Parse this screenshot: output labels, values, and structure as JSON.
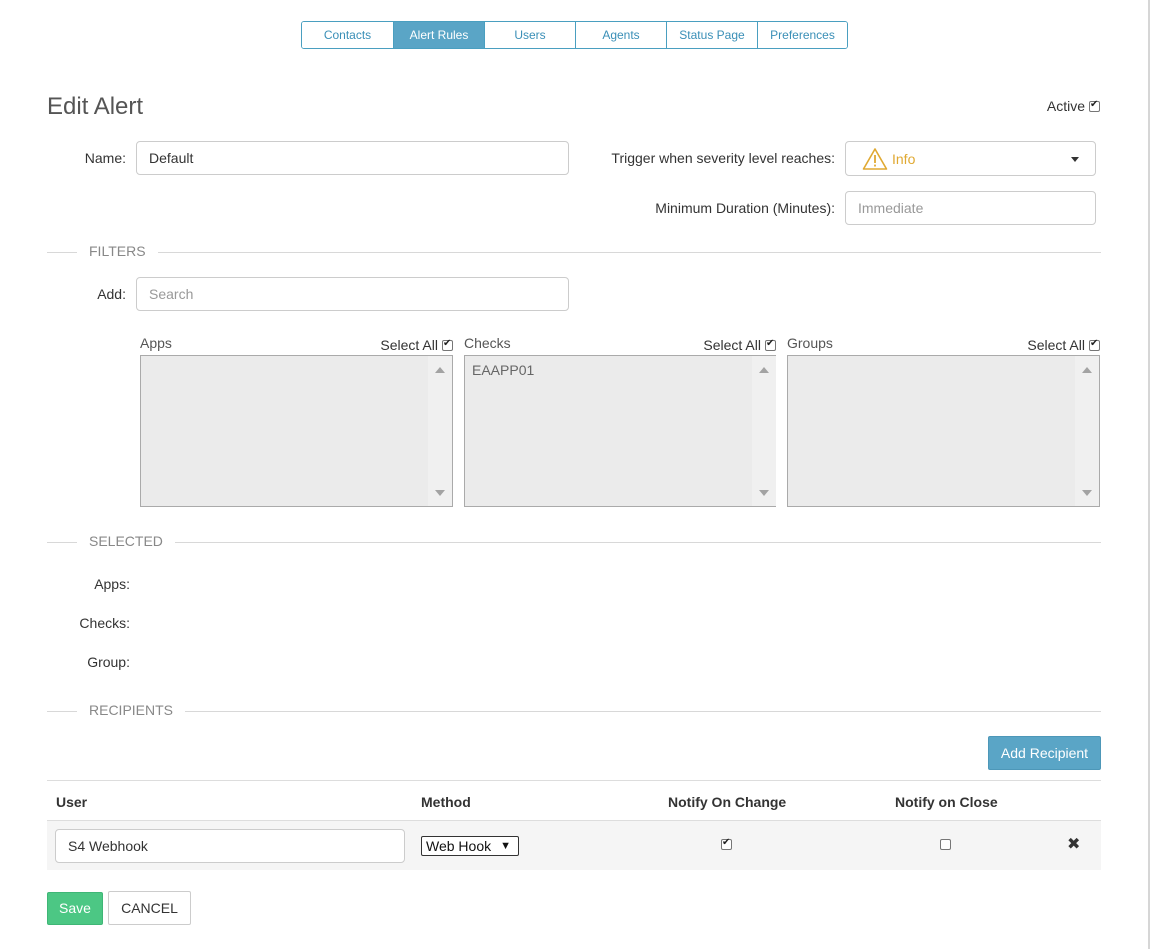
{
  "tabs": [
    {
      "label": "Contacts",
      "active": false
    },
    {
      "label": "Alert Rules",
      "active": true
    },
    {
      "label": "Users",
      "active": false
    },
    {
      "label": "Agents",
      "active": false
    },
    {
      "label": "Status Page",
      "active": false
    },
    {
      "label": "Preferences",
      "active": false
    }
  ],
  "page": {
    "title": "Edit Alert",
    "active_label": "Active",
    "active_checked": true
  },
  "form": {
    "name_label": "Name:",
    "name_value": "Default",
    "trigger_label": "Trigger when severity level reaches:",
    "severity_value": "Info",
    "severity_icon": "warning-triangle-icon",
    "min_duration_label": "Minimum Duration (Minutes):",
    "min_duration_placeholder": "Immediate"
  },
  "filters": {
    "section_label": "FILTERS",
    "add_label": "Add:",
    "search_placeholder": "Search",
    "lists": [
      {
        "name": "Apps",
        "select_all": "Select All",
        "checked": true,
        "items": []
      },
      {
        "name": "Checks",
        "select_all": "Select All",
        "checked": true,
        "items": [
          "EAAPP01"
        ]
      },
      {
        "name": "Groups",
        "select_all": "Select All",
        "checked": true,
        "items": []
      }
    ]
  },
  "selected": {
    "section_label": "SELECTED",
    "apps_label": "Apps:",
    "checks_label": "Checks:",
    "group_label": "Group:"
  },
  "recipients": {
    "section_label": "RECIPIENTS",
    "add_button": "Add Recipient",
    "columns": {
      "user": "User",
      "method": "Method",
      "notify_change": "Notify On Change",
      "notify_close": "Notify on Close"
    },
    "rows": [
      {
        "user": "S4 Webhook",
        "method": "Web Hook",
        "notify_change": true,
        "notify_close": false
      }
    ]
  },
  "actions": {
    "save": "Save",
    "cancel": "CANCEL"
  },
  "colors": {
    "accent": "#5aa5c6",
    "save_green": "#4cc784",
    "severity_yellow": "#e0a932"
  }
}
